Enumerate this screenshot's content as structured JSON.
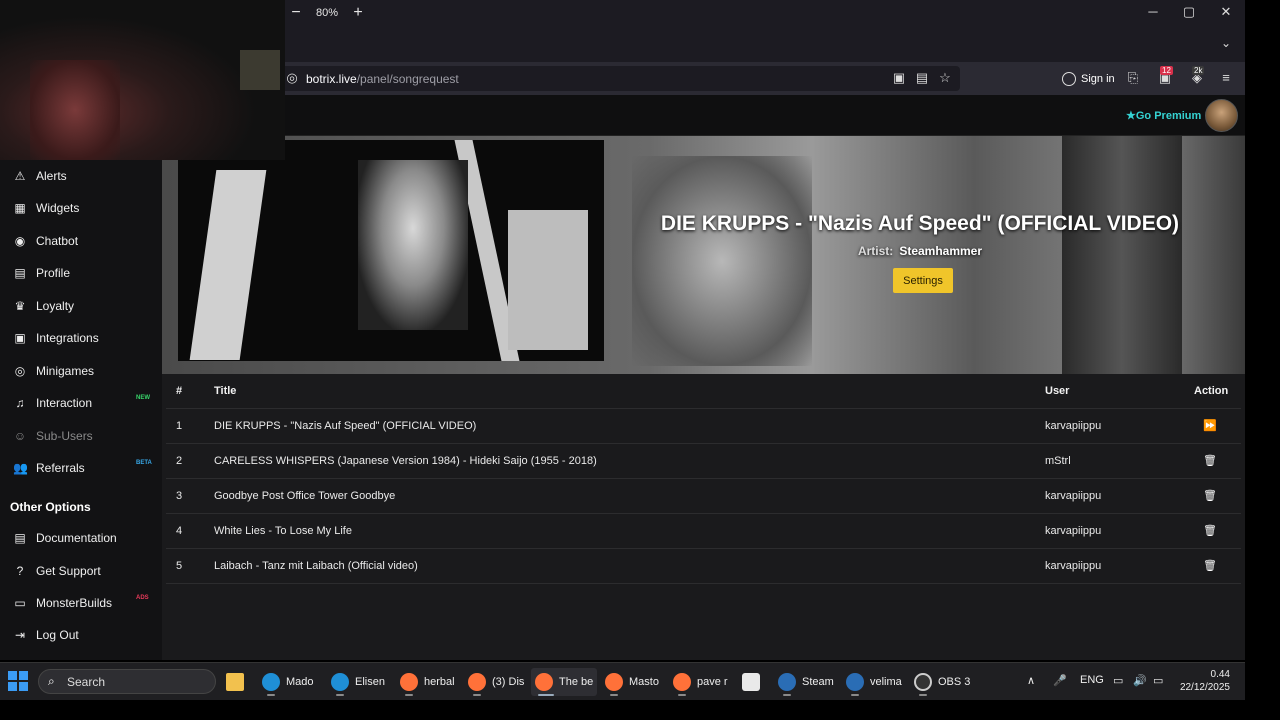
{
  "browser": {
    "zoom": "80%",
    "zoom_out": "−",
    "zoom_in": "+",
    "minimize": "─",
    "maximize": "▢",
    "close": "✕",
    "tabs_chevron": "⌄",
    "url_host": "botrix.live",
    "url_path": "/panel/songrequest",
    "sign_in": "Sign in",
    "badge_1": "12",
    "badge_2": "2k"
  },
  "header": {
    "premium": "Go Premium",
    "premium_star": "★"
  },
  "sidebar": {
    "items": [
      {
        "label": "Alerts",
        "icon": "⚠"
      },
      {
        "label": "Widgets",
        "icon": "▦"
      },
      {
        "label": "Chatbot",
        "icon": "◉"
      },
      {
        "label": "Profile",
        "icon": "▤"
      },
      {
        "label": "Loyalty",
        "icon": "♛"
      },
      {
        "label": "Integrations",
        "icon": "▣"
      },
      {
        "label": "Minigames",
        "icon": "◎"
      },
      {
        "label": "Interaction",
        "icon": "♫",
        "tag": "NEW"
      },
      {
        "label": "Sub-Users",
        "icon": "☺"
      },
      {
        "label": "Referrals",
        "icon": "👥",
        "tag": "BETA"
      }
    ],
    "other_heading": "Other Options",
    "other_items": [
      {
        "label": "Documentation",
        "icon": "▤"
      },
      {
        "label": "Get Support",
        "icon": "?"
      },
      {
        "label": "MonsterBuilds",
        "icon": "▭",
        "tag": "ADS"
      },
      {
        "label": "Log Out",
        "icon": "⇥"
      }
    ]
  },
  "now_playing": {
    "title": "DIE KRUPPS - \"Nazis Auf Speed\" (OFFICIAL VIDEO)",
    "artist_label": "Artist:",
    "artist": "Steamhammer",
    "settings": "Settings"
  },
  "queue": {
    "columns": [
      "#",
      "Title",
      "User",
      "Action"
    ],
    "rows": [
      {
        "num": "1",
        "title": "DIE KRUPPS - \"Nazis Auf Speed\" (OFFICIAL VIDEO)",
        "user": "karvapiippu",
        "action": "⏩"
      },
      {
        "num": "2",
        "title": "CARELESS WHISPERS (Japanese Version 1984) - Hideki Saijo (1955 - 2018)",
        "user": "mStrl",
        "action": "🗑"
      },
      {
        "num": "3",
        "title": "Goodbye Post Office Tower Goodbye",
        "user": "karvapiippu",
        "action": "🗑"
      },
      {
        "num": "4",
        "title": "White Lies - To Lose My Life",
        "user": "karvapiippu",
        "action": "🗑"
      },
      {
        "num": "5",
        "title": "Laibach - Tanz mit Laibach (Official video)",
        "user": "karvapiippu",
        "action": "🗑"
      }
    ]
  },
  "taskbar": {
    "search": "Search",
    "apps": [
      {
        "label": "",
        "color": "#f2c14e"
      },
      {
        "label": "Mado",
        "color": "#1f8fd6"
      },
      {
        "label": "Elisen",
        "color": "#1f8fd6"
      },
      {
        "label": "herbal",
        "color": "#ff7139"
      },
      {
        "label": "(3) Dis",
        "color": "#ff7139"
      },
      {
        "label": "The be",
        "color": "#ff7139"
      },
      {
        "label": "Masto",
        "color": "#ff7139"
      },
      {
        "label": "pave r",
        "color": "#ff7139"
      },
      {
        "label": "",
        "color": "#e9e9e9"
      },
      {
        "label": "Steam",
        "color": "#2a6db5"
      },
      {
        "label": "velima",
        "color": "#2a6db5"
      },
      {
        "label": "OBS 3",
        "color": "#333"
      }
    ],
    "lang": "ENG",
    "time": "0.44",
    "date": "22/12/2025"
  },
  "colors": {
    "accent_teal": "#35d2d2",
    "settings_yellow": "#f0c52a",
    "new_tag": "#38d66b",
    "beta_tag": "#38a8e8",
    "ads_tag": "#e83a5a"
  }
}
